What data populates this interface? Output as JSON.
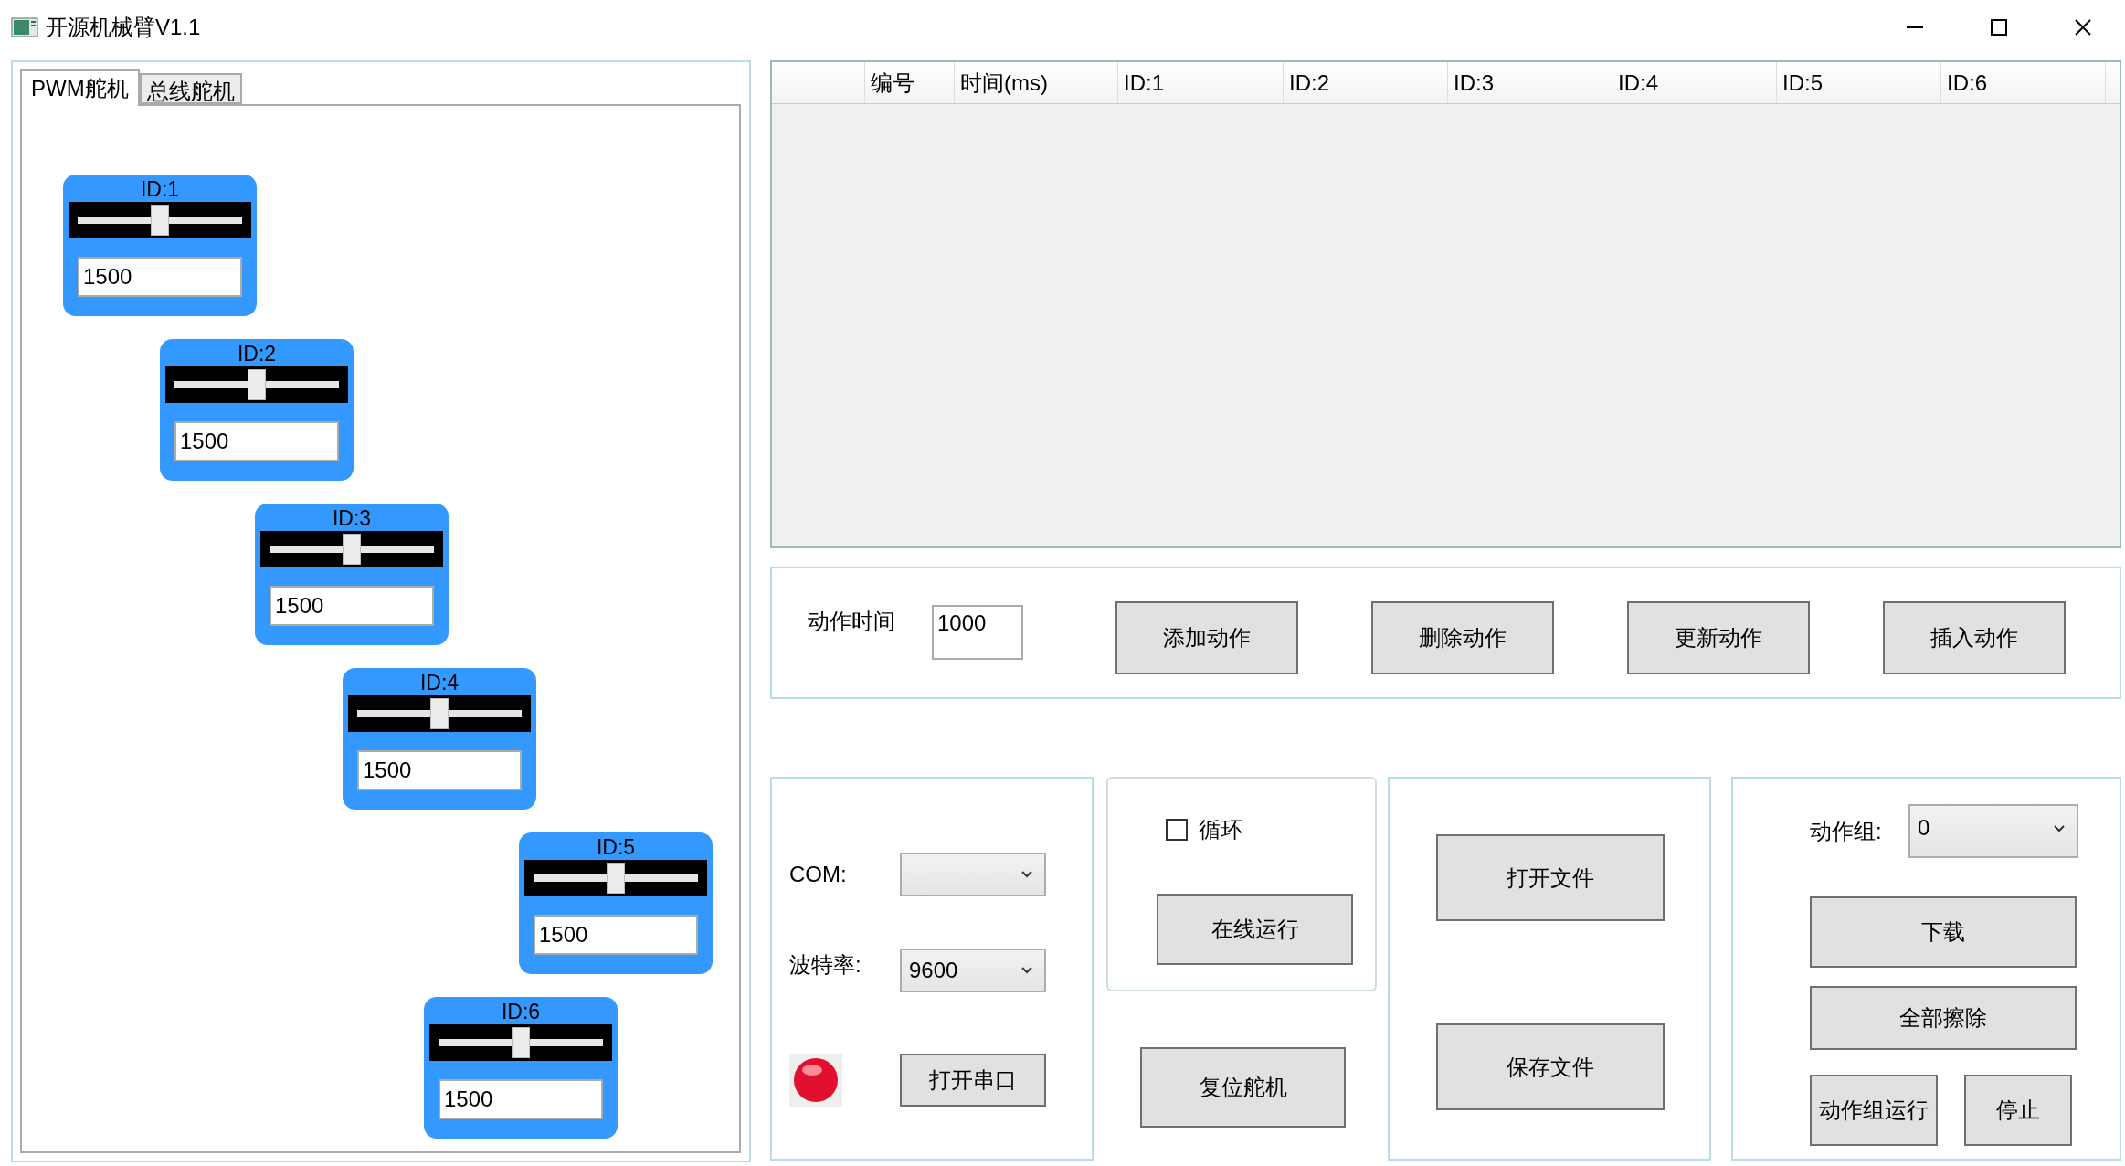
{
  "window": {
    "title": "开源机械臂V1.1"
  },
  "left_tabs": [
    {
      "label": "PWM舵机",
      "selected": true
    },
    {
      "label": "总线舵机",
      "selected": false
    }
  ],
  "servos": [
    {
      "label": "ID:1",
      "level": 0.5,
      "value": "1500"
    },
    {
      "label": "ID:2",
      "level": 0.5,
      "value": "1500"
    },
    {
      "label": "ID:3",
      "level": 0.5,
      "value": "1500"
    },
    {
      "label": "ID:4",
      "level": 0.5,
      "value": "1500"
    },
    {
      "label": "ID:5",
      "level": 0.5,
      "value": "1500"
    },
    {
      "label": "ID:6",
      "level": 0.5,
      "value": "1500"
    }
  ],
  "table": {
    "columns": [
      "编号",
      "时间(ms)",
      "ID:1",
      "ID:2",
      "ID:3",
      "ID:4",
      "ID:5",
      "ID:6"
    ]
  },
  "action_panel": {
    "time_label": "动作时间",
    "time_value": "1000",
    "buttons": [
      "添加动作",
      "删除动作",
      "更新动作",
      "插入动作"
    ]
  },
  "serial": {
    "com_label": "COM:",
    "baud_label": "波特率:",
    "baud_value": "9600",
    "open_button": "打开串口"
  },
  "run_panel": {
    "loop": {
      "label": "循环",
      "checked": false
    },
    "online_button": "在线运行"
  },
  "reset_button": "复位舵机",
  "file_panel": {
    "buttons": [
      "打开文件",
      "保存文件"
    ]
  },
  "group_panel": {
    "label": "动作组:",
    "value": "0",
    "download_button": "下载",
    "erase_button": "全部擦除",
    "run_button": "动作组运行",
    "stop_button": "停止"
  }
}
